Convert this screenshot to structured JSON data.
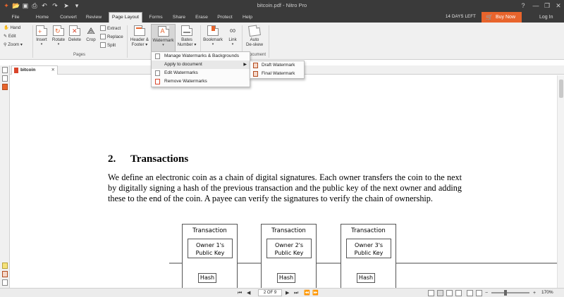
{
  "window": {
    "title": "bitcoin.pdf - Nitro Pro",
    "quick_access": [
      "app-logo-icon",
      "open-icon",
      "save-icon",
      "print-icon",
      "undo-icon",
      "redo-icon",
      "cursor-icon",
      "customize-icon"
    ]
  },
  "tabs": [
    "File",
    "Home",
    "Convert",
    "Review",
    "Page Layout",
    "Forms",
    "Share",
    "Erase",
    "Protect",
    "Help"
  ],
  "active_tab": "Page Layout",
  "trial_text": "14 DAYS LEFT",
  "buy_now": "Buy Now",
  "login": "Log In",
  "ribbon": {
    "tools": {
      "hand": "Hand",
      "edit": "Edit",
      "zoom": "Zoom"
    },
    "pages": {
      "insert": "Insert",
      "rotate": "Rotate",
      "delete": "Delete",
      "crop": "Crop",
      "extract": "Extract",
      "replace": "Replace",
      "split": "Split",
      "group_label": "Pages"
    },
    "page_marks": {
      "header_footer": "Header &",
      "header_footer_2": "Footer",
      "watermark": "Watermark",
      "bates": "Bates",
      "bates_2": "Number"
    },
    "navigation": {
      "bookmark": "Bookmark",
      "link": "Link"
    },
    "document": {
      "auto": "Auto",
      "deskew": "De-skew",
      "group_label": "ocument"
    }
  },
  "watermark_menu": [
    {
      "label": "Manage Watermarks & Backgrounds"
    },
    {
      "label": "Apply to document",
      "has_submenu": true
    },
    {
      "label": "Edit Watermarks"
    },
    {
      "label": "Remove Watermarks"
    }
  ],
  "submenu": [
    "Draft Watermark",
    "Final Watermark"
  ],
  "document_tab": "bitcoin",
  "document": {
    "heading_number": "2.",
    "heading_title": "Transactions",
    "paragraph": "We define an electronic coin as a chain of digital signatures.  Each owner transfers the coin to the next by digitally signing a hash of the previous transaction and the public key of the next owner and adding these to the end of the coin.  A payee can verify the signatures to verify the chain of ownership.",
    "diagram": {
      "transactions": [
        {
          "label": "Transaction",
          "owner_line1": "Owner 1's",
          "owner_line2": "Public Key",
          "hash": "Hash"
        },
        {
          "label": "Transaction",
          "owner_line1": "Owner 2's",
          "owner_line2": "Public Key",
          "hash": "Hash"
        },
        {
          "label": "Transaction",
          "owner_line1": "Owner 3's",
          "owner_line2": "Public Key",
          "hash": "Hash"
        }
      ]
    }
  },
  "status": {
    "page_indicator": "2 OF 9",
    "zoom": "170%"
  },
  "colors": {
    "titlebar": "#3a3a3a",
    "accent": "#e8642c",
    "ribbon": "#f0f0f0"
  }
}
